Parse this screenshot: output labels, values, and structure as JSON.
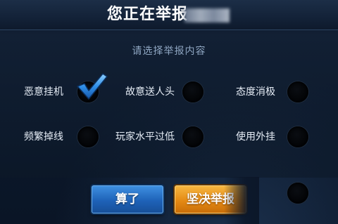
{
  "dialog": {
    "title": "您正在举报",
    "subtitle": "请选择举报内容"
  },
  "options": [
    {
      "label": "恶意挂机",
      "selected": true
    },
    {
      "label": "故意送人头",
      "selected": false
    },
    {
      "label": "态度消极",
      "selected": false
    },
    {
      "label": "频繁掉线",
      "selected": false
    },
    {
      "label": "玩家水平过低",
      "selected": false
    },
    {
      "label": "使用外挂",
      "selected": false
    }
  ],
  "buttons": {
    "cancel_label": "算了",
    "confirm_label": "坚决举报"
  },
  "icons": {
    "selected": "checkmark-icon"
  },
  "colors": {
    "cancel_button": "#1e62b8",
    "confirm_button": "#e58a14",
    "checkmark": "#2f8fe8"
  }
}
